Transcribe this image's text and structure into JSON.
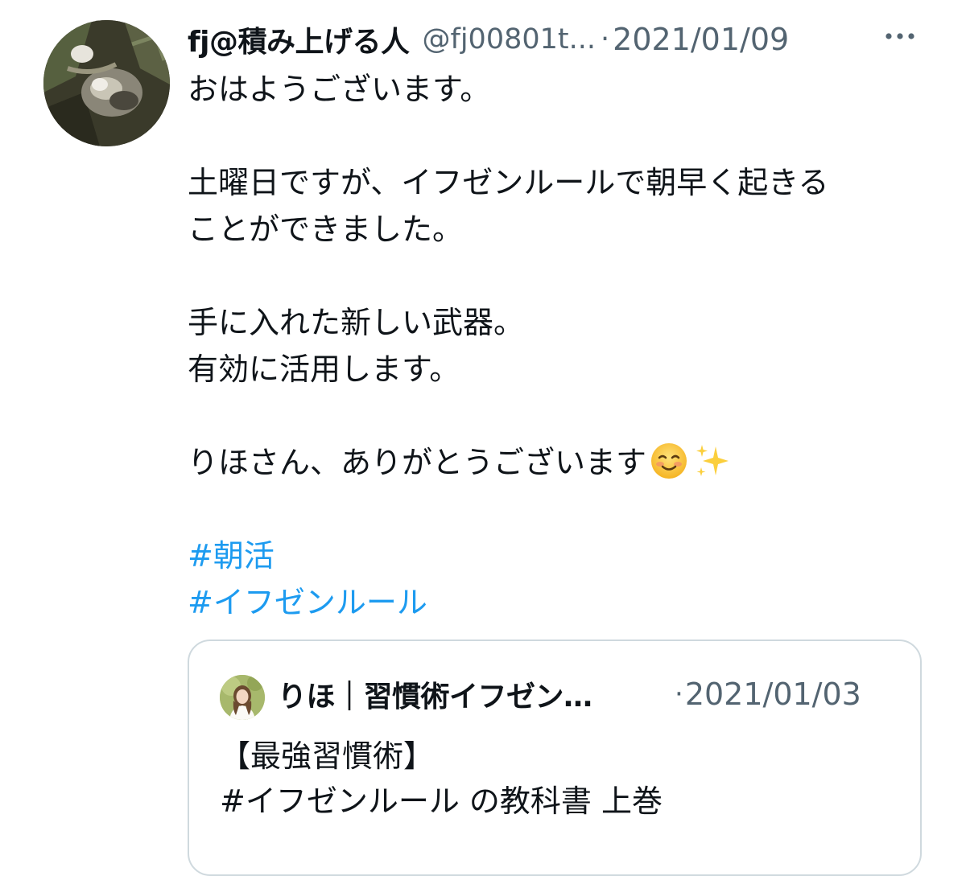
{
  "tweet": {
    "display_name": "fj@積み上げる人",
    "handle": "@fj00801t...",
    "separator": "·",
    "date": "2021/01/09",
    "more_icon": "more-horizontal-icon",
    "avatar_icon": "cat-photo-avatar",
    "lines": {
      "l1": "おはようございます。",
      "l2": "土曜日ですが、イフゼンルールで朝早く起きる",
      "l3": "ことができました。",
      "l4": "手に入れた新しい武器。",
      "l5": "有効に活用します。",
      "l6": "りほさん、ありがとうございます"
    },
    "emojis": [
      "smiling-face-icon",
      "sparkles-icon"
    ],
    "hashtags": [
      "#朝活",
      "#イフゼンルール"
    ]
  },
  "quote": {
    "avatar_icon": "profile-photo-avatar",
    "display_name": "りほ｜習慣術イフゼン…",
    "separator": "·",
    "date": "2021/01/03",
    "line1": "【最強習慣術】",
    "line2": "#イフゼンルール の教科書 上巻"
  },
  "colors": {
    "text": "#0f1419",
    "muted": "#536471",
    "link": "#1d9bf0",
    "border": "#cfd9de"
  }
}
